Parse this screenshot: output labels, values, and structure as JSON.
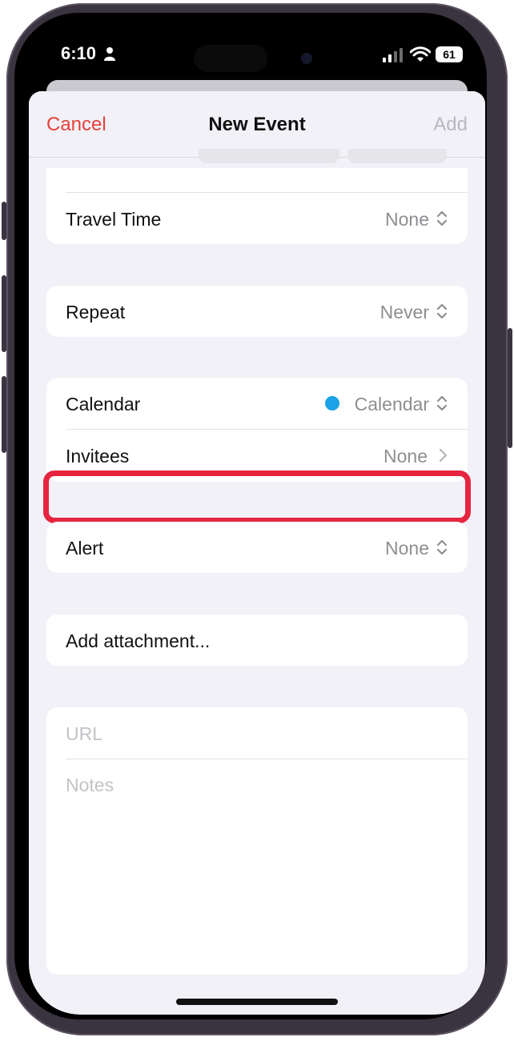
{
  "status_bar": {
    "time": "6:10",
    "battery": "61"
  },
  "nav": {
    "cancel": "Cancel",
    "title": "New Event",
    "add": "Add"
  },
  "rows": {
    "travel_time": {
      "label": "Travel Time",
      "value": "None"
    },
    "repeat": {
      "label": "Repeat",
      "value": "Never"
    },
    "calendar": {
      "label": "Calendar",
      "value": "Calendar",
      "dot_color": "#1aa1e6"
    },
    "invitees": {
      "label": "Invitees",
      "value": "None"
    },
    "alert": {
      "label": "Alert",
      "value": "None"
    },
    "attachment": {
      "label": "Add attachment..."
    }
  },
  "fields": {
    "url_placeholder": "URL",
    "notes_placeholder": "Notes"
  },
  "colors": {
    "accent_red": "#e8413b",
    "highlight": "#e5253f",
    "calendar_dot": "#1aa1e6"
  }
}
